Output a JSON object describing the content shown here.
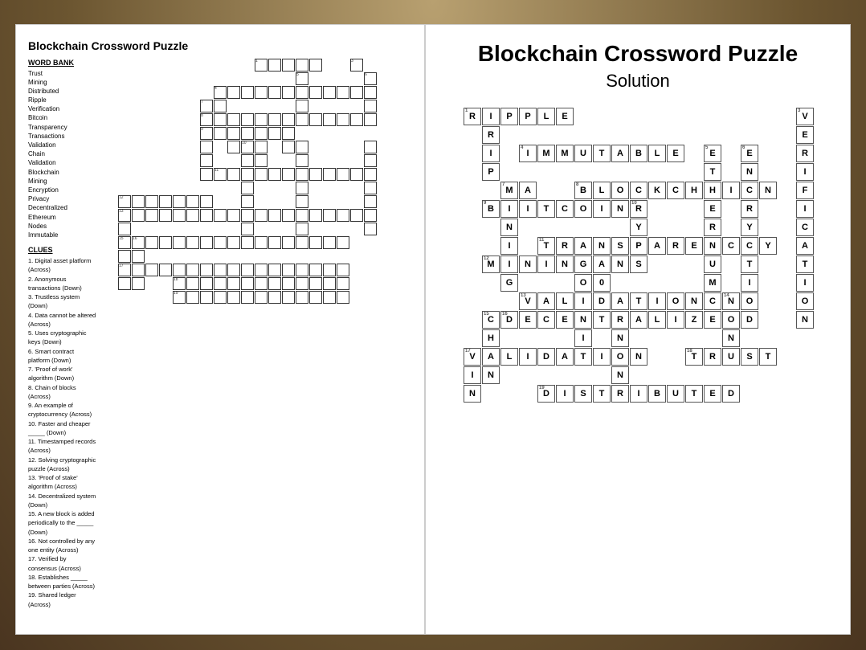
{
  "left": {
    "title": "Blockchain Crossword Puzzle",
    "word_bank_title": "WORD BANK",
    "words": [
      "Trust",
      "Mining",
      "Distributed",
      "Ripple",
      "Verification",
      "Bitcoin",
      "Transparency",
      "Transactions",
      "Validation",
      "Chain",
      "Validation",
      "Blockchain",
      "Mining",
      "Encryption",
      "Privacy",
      "Decentralized",
      "Ethereum",
      "Nodes",
      "Immutable"
    ],
    "clues_title": "CLUES",
    "clues": [
      "1. Digital asset platform (Across)",
      "2. Anonymous transactions (Down)",
      "3. Trustless system (Down)",
      "4. Data cannot be altered (Across)",
      "5. Uses cryptographic keys (Down)",
      "6. Smart contract platform (Down)",
      "7. 'Proof of work' algorithm (Down)",
      "8. Chain of blocks (Across)",
      "9. An example of cryptocurrency (Across)",
      "10. Faster and cheaper _____ (Down)",
      "11. Timestamped records (Across)",
      "12. Solving cryptographic puzzle (Across)",
      "13. 'Proof of stake' algorithm (Across)",
      "14. Decentralized system (Down)",
      "15. A new block is added periodically to the _____ (Down)",
      "16. Not controlled by any one entity (Across)",
      "17. Verified by consensus (Across)",
      "18. Establishes _____ between parties (Across)",
      "19. Shared ledger (Across)"
    ]
  },
  "right": {
    "title": "Blockchain Crossword Puzzle",
    "subtitle": "Solution"
  }
}
